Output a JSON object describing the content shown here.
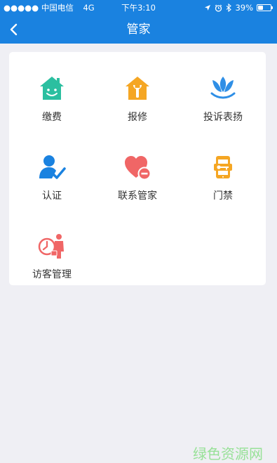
{
  "status_bar": {
    "carrier": "●●●●● 中国电信",
    "network": "4G",
    "time": "下午3:10",
    "battery_percent": "39%",
    "battery_level": 0.39
  },
  "nav": {
    "title": "管家",
    "back_icon": "chevron-left-icon"
  },
  "grid": [
    {
      "label": "缴费",
      "icon": "smiling-house-icon",
      "color": "#2bbfa0"
    },
    {
      "label": "报修",
      "icon": "wrench-house-icon",
      "color": "#f5a623"
    },
    {
      "label": "投诉表扬",
      "icon": "tulip-icon",
      "color": "#2f8fe6"
    },
    {
      "label": "认证",
      "icon": "verified-user-icon",
      "color": "#1a82e0"
    },
    {
      "label": "联系管家",
      "icon": "heart-minus-icon",
      "color": "#f06666"
    },
    {
      "label": "门禁",
      "icon": "access-phone-key-icon",
      "color": "#f5a623"
    },
    {
      "label": "访客管理",
      "icon": "visitor-clock-icon",
      "color": "#f06666"
    }
  ],
  "colors": {
    "nav_bar": "#1a82e0",
    "background": "#efeff4",
    "card": "#ffffff",
    "label_text": "#333333"
  },
  "watermark": "绿色资源网"
}
